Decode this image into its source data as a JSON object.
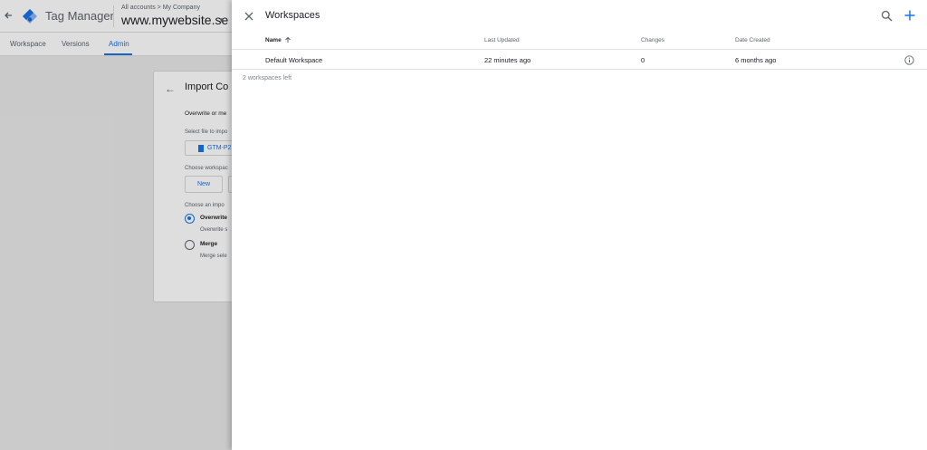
{
  "app": {
    "title": "Tag Manager",
    "breadcrumb": "All accounts > My Company",
    "container_name": "www.mywebsite.se",
    "brand_color": "#1a73e8"
  },
  "nav_tabs": [
    {
      "label": "Workspace",
      "active": false
    },
    {
      "label": "Versions",
      "active": false
    },
    {
      "label": "Admin",
      "active": true
    }
  ],
  "import_card": {
    "title": "Import Co",
    "intro": "Overwrite or me",
    "select_file_label": "Select file to impo",
    "file_name": "GTM-P2",
    "choose_workspace_label": "Choose workspac",
    "new_button": "New",
    "choose_option_label": "Choose an impo",
    "options": [
      {
        "label": "Overwrite",
        "description": "Overwrite s",
        "selected": true
      },
      {
        "label": "Merge",
        "description": "Merge sele",
        "selected": false
      }
    ]
  },
  "panel": {
    "title": "Workspaces",
    "columns": {
      "name": "Name",
      "last_updated": "Last Updated",
      "changes": "Changes",
      "date_created": "Date Created"
    },
    "rows": [
      {
        "name": "Default Workspace",
        "last_updated": "22 minutes ago",
        "changes": "0",
        "date_created": "6 months ago"
      }
    ],
    "footer": "2 workspaces left",
    "icons": {
      "close": "close-icon",
      "search": "search-icon",
      "add": "plus-icon",
      "sort": "arrow-up-icon",
      "info": "info-icon"
    }
  }
}
